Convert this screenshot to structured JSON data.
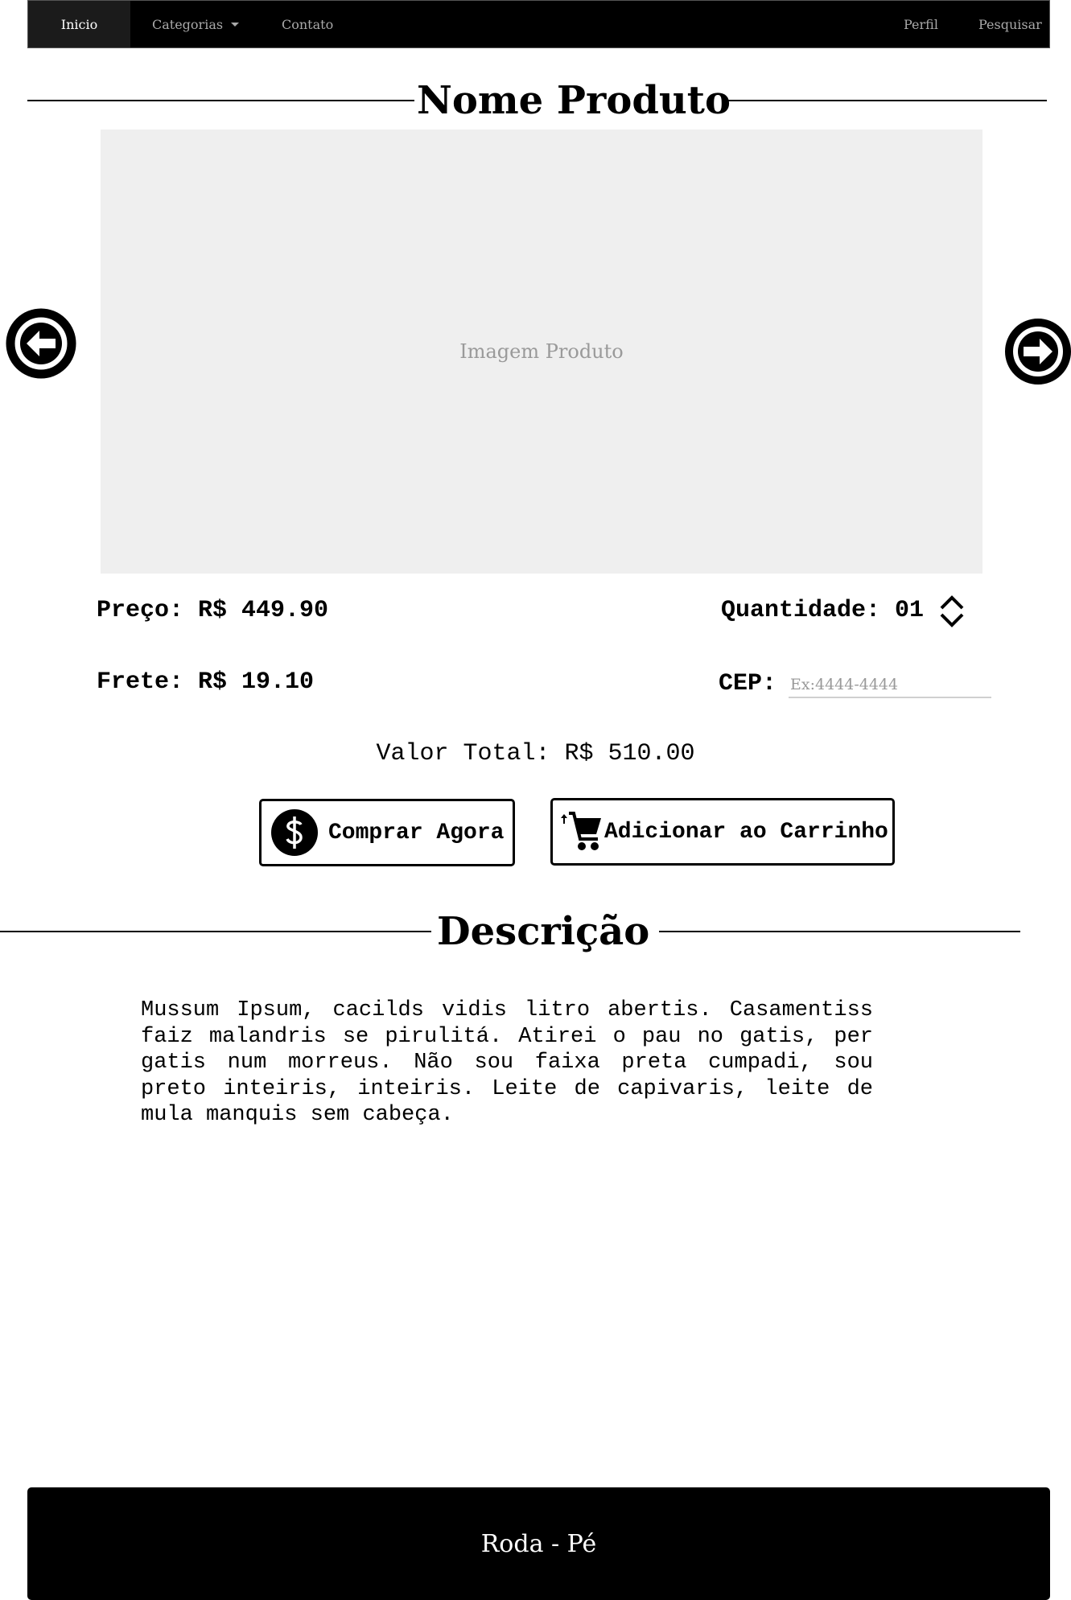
{
  "navbar": {
    "items": [
      {
        "label": "Inicio",
        "active": true
      },
      {
        "label": "Categorias",
        "has_dropdown": true
      },
      {
        "label": "Contato"
      },
      {
        "label": "Perfil"
      },
      {
        "label": "Pesquisar"
      }
    ]
  },
  "product": {
    "title": "Nome Produto",
    "image_placeholder": "Imagem Produto",
    "price": "Preço: R$ 449.90",
    "quantity": "Quantidade: 01",
    "shipping": "Frete: R$ 19.10",
    "cep_label": "CEP:",
    "cep_placeholder": "Ex:4444-4444",
    "total": "Valor Total: R$ 510.00"
  },
  "actions": {
    "buy_now": "Comprar Agora",
    "add_to_cart": "Adicionar ao Carrinho"
  },
  "description": {
    "title": "Descrição",
    "text": "Mussum Ipsum, cacilds vidis litro abertis. Casamentiss faiz malandris se pirulitá. Atirei o pau no gatis, per gatis num morreus. Não sou faixa preta cumpadi, sou preto inteiris, inteiris. Leite de capivaris, leite de mula manquis sem cabeça."
  },
  "footer": {
    "text": "Roda - Pé"
  },
  "icons": {
    "prev": "arrow-left-circle-icon",
    "next": "arrow-right-circle-icon",
    "quantity": "chevron-up-down-icon",
    "buy": "dollar-circle-icon",
    "cart": "cart-plus-icon"
  },
  "colors": {
    "navbar_bg": "#000000",
    "navbar_active": "#1b1b1b",
    "nav_text": "#a9a9a9",
    "image_bg": "#efefef",
    "footer_bg": "#000000"
  }
}
